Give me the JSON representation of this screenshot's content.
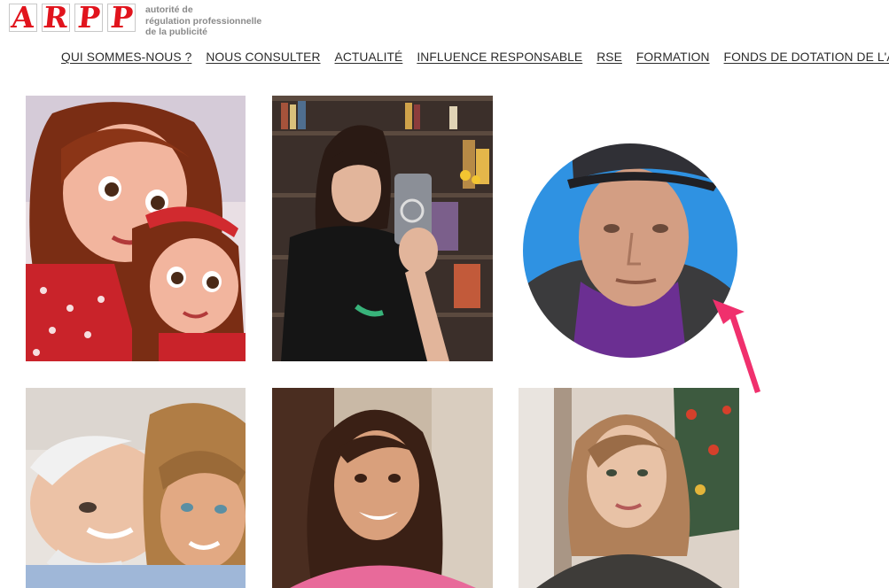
{
  "logo": {
    "letters": [
      "A",
      "R",
      "P",
      "P"
    ],
    "tagline": [
      "autorité de",
      "régulation professionnelle",
      "de la publicité"
    ]
  },
  "nav": {
    "items": [
      {
        "label": "QUI SOMMES-NOUS ?"
      },
      {
        "label": "NOUS CONSULTER"
      },
      {
        "label": "ACTUALITÉ"
      },
      {
        "label": "INFLUENCE RESPONSABLE"
      },
      {
        "label": "RSE"
      },
      {
        "label": "FORMATION"
      },
      {
        "label": "FONDS DE DOTATION DE L'ARPP"
      }
    ]
  },
  "colors": {
    "brand_red": "#e1141d",
    "arrow_pink": "#f0306d",
    "circle_blue": "#2f92e2"
  },
  "portraits": [
    {
      "name": "cartoon-mother-daughter-portrait"
    },
    {
      "name": "mirror-selfie-portrait"
    },
    {
      "name": "man-in-cap-portrait"
    },
    {
      "name": "elderly-man-and-woman-portrait"
    },
    {
      "name": "smiling-woman-portrait"
    },
    {
      "name": "young-woman-portrait"
    }
  ]
}
